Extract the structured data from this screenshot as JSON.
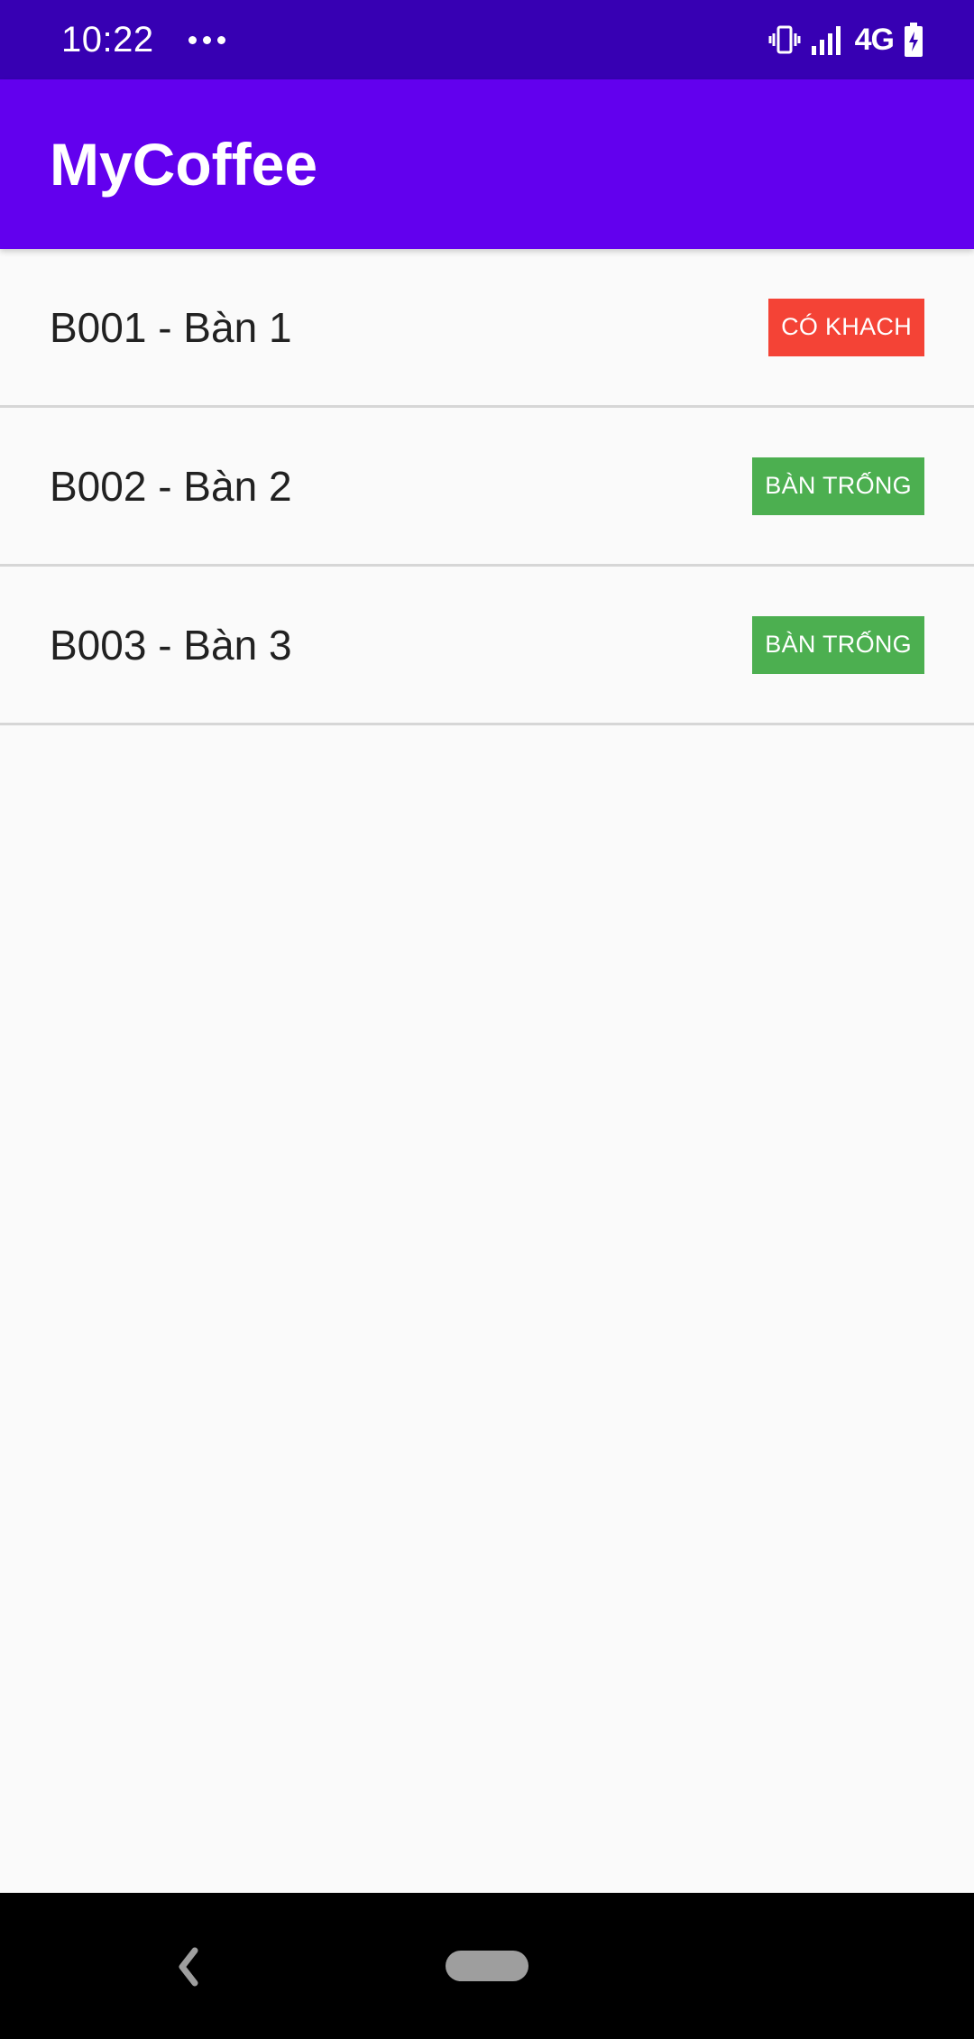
{
  "status_bar": {
    "time": "10:22",
    "network": "4G",
    "icons": [
      "more-dots-icon",
      "vibrate-icon",
      "signal-icon",
      "battery-charging-icon"
    ]
  },
  "app_bar": {
    "title": "MyCoffee",
    "color": "#6200ee"
  },
  "tables": [
    {
      "label": "B001 - Bàn 1",
      "status": "CÓ KHACH",
      "status_color": "#f44336"
    },
    {
      "label": "B002 - Bàn 2",
      "status": "BÀN TRỐNG",
      "status_color": "#4caf50"
    },
    {
      "label": "B003 - Bàn 3",
      "status": "BÀN TRỐNG",
      "status_color": "#4caf50"
    }
  ],
  "nav_bar": {
    "icons": [
      "back-icon",
      "home-pill-icon"
    ]
  },
  "colors": {
    "status_bar": "#3700b3",
    "background": "#fafafa",
    "nav_bar": "#000000"
  }
}
